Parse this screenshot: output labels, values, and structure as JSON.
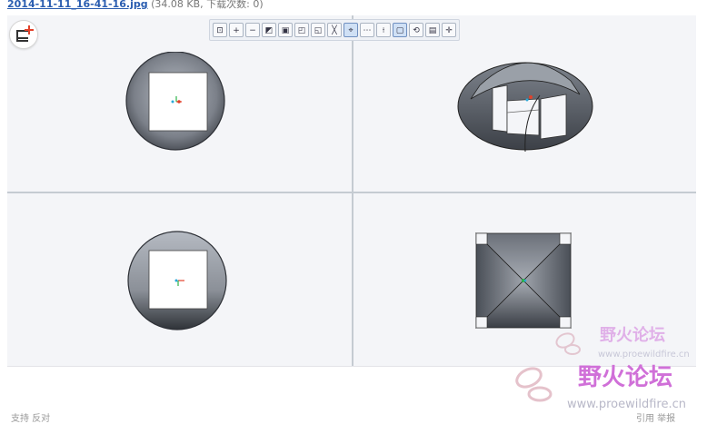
{
  "caption": {
    "filename": "2014-11-11_16-41-16.jpg",
    "meta": "(34.08 KB, 下载次数: 0)"
  },
  "toolbar": {
    "buttons": [
      {
        "name": "zoom-fit-icon",
        "glyph": "⊡"
      },
      {
        "name": "zoom-in-icon",
        "glyph": "+"
      },
      {
        "name": "zoom-out-icon",
        "glyph": "−"
      },
      {
        "name": "repaint-icon",
        "glyph": "◩"
      },
      {
        "name": "shading-icon",
        "glyph": "▣"
      },
      {
        "name": "shading-edges-icon",
        "glyph": "◰"
      },
      {
        "name": "hidden-line-icon",
        "glyph": "◱"
      },
      {
        "name": "datum-planes-icon",
        "glyph": "╳"
      },
      {
        "name": "datum-axes-icon",
        "glyph": "⌖",
        "active": true
      },
      {
        "name": "datum-points-icon",
        "glyph": "⋯"
      },
      {
        "name": "coordinate-system-icon",
        "glyph": "⟊"
      },
      {
        "name": "view-manager-icon",
        "glyph": "▢",
        "active": true
      },
      {
        "name": "saved-views-icon",
        "glyph": "⟲"
      },
      {
        "name": "layers-icon",
        "glyph": "▤"
      },
      {
        "name": "spin-center-icon",
        "glyph": "✛"
      }
    ]
  },
  "watermarks": {
    "brand": "野火论坛",
    "url": "www.proewildfire.cn"
  },
  "footer": {
    "left": "支持  反对",
    "right": "引用  举报"
  },
  "colors": {
    "background": "#f4f5f8",
    "metal_dark": "#555a63",
    "metal_light": "#c9ced6",
    "accent": "#e2412a",
    "watermark": "#c040c0"
  }
}
